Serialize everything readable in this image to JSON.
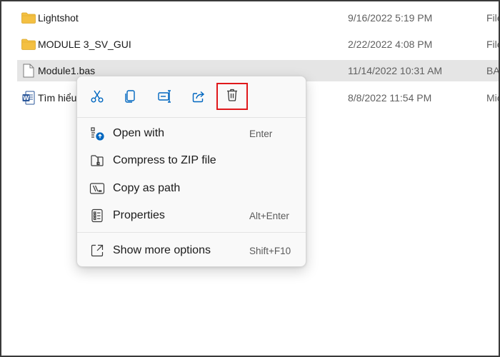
{
  "files": [
    {
      "name": "Lightshot",
      "date": "9/16/2022 5:19 PM",
      "type": "File",
      "icon": "folder-icon",
      "selected": false
    },
    {
      "name": "MODULE 3_SV_GUI",
      "date": "2/22/2022 4:08 PM",
      "type": "File",
      "icon": "folder-icon",
      "selected": false
    },
    {
      "name": "Module1.bas",
      "date": "11/14/2022 10:31 AM",
      "type": "BA",
      "icon": "file-icon",
      "selected": true
    },
    {
      "name": "Tìm hiểu",
      "date": "8/8/2022 11:54 PM",
      "type": "Mic",
      "icon": "word-doc-icon",
      "selected": false
    }
  ],
  "context_menu": {
    "quick_actions": [
      {
        "name": "cut-icon"
      },
      {
        "name": "copy-icon"
      },
      {
        "name": "rename-icon"
      },
      {
        "name": "share-icon"
      },
      {
        "name": "delete-icon",
        "highlighted": true
      }
    ],
    "items": [
      {
        "label": "Open with",
        "shortcut": "Enter",
        "icon": "open-with-icon"
      },
      {
        "label": "Compress to ZIP file",
        "shortcut": "",
        "icon": "zip-icon"
      },
      {
        "label": "Copy as path",
        "shortcut": "",
        "icon": "copy-path-icon"
      },
      {
        "label": "Properties",
        "shortcut": "Alt+Enter",
        "icon": "properties-icon"
      }
    ],
    "more": {
      "label": "Show more options",
      "shortcut": "Shift+F10",
      "icon": "show-more-icon"
    }
  },
  "colors": {
    "accent": "#0067c0",
    "highlight_border": "#e0181b",
    "folder": "#f4c042",
    "selected_row": "#e5e5e5"
  }
}
